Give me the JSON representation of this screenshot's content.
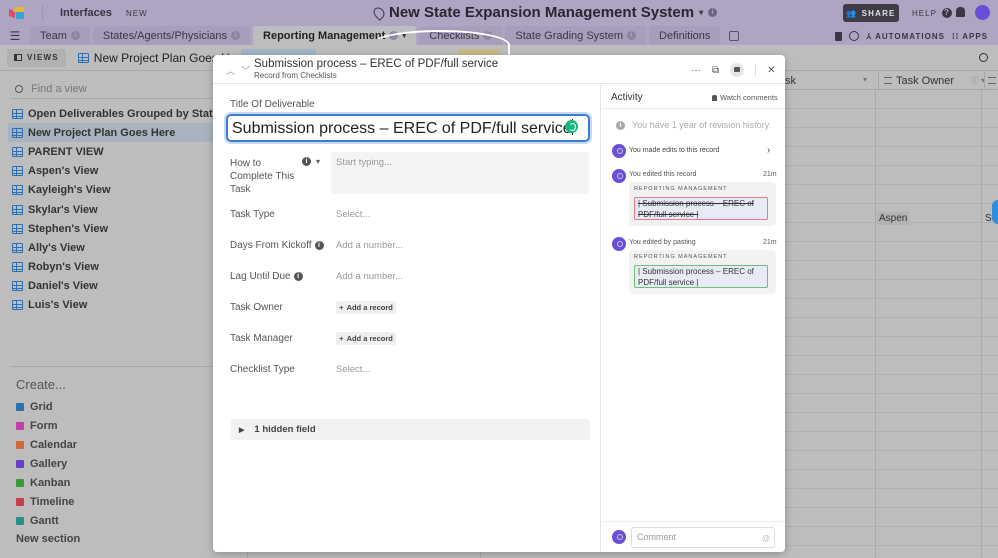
{
  "header": {
    "interfaces_label": "Interfaces",
    "new_badge": "NEW",
    "base_title": "New State Expansion Management System",
    "share_label": "SHARE",
    "help_label": "HELP"
  },
  "tabs": [
    {
      "label": "Team"
    },
    {
      "label": "States/Agents/Physicians"
    },
    {
      "label": "Reporting Management"
    },
    {
      "label": "Checklists"
    },
    {
      "label": "State Grading System"
    },
    {
      "label": "Definitions"
    }
  ],
  "toolbar_right": {
    "automations_label": "AUTOMATIONS",
    "apps_label": "APPS"
  },
  "viewbar": {
    "views_label": "VIEWS",
    "current_view": "New Project Plan Goes Here"
  },
  "sidebar": {
    "find_placeholder": "Find a view",
    "views": [
      {
        "label": "Open Deliverables Grouped by State/Agent/Physicians"
      },
      {
        "label": "New Project Plan Goes Here"
      },
      {
        "label": "PARENT VIEW"
      },
      {
        "label": "Aspen's View"
      },
      {
        "label": "Kayleigh's View"
      },
      {
        "label": "Skylar's View"
      },
      {
        "label": "Stephen's View"
      },
      {
        "label": "Ally's View"
      },
      {
        "label": "Robyn's View"
      },
      {
        "label": "Daniel's View"
      },
      {
        "label": "Luis's View"
      }
    ],
    "create_label": "Create...",
    "create_items": [
      {
        "label": "Grid",
        "color": "#2e6fb0"
      },
      {
        "label": "Form",
        "color": "#c13fa8"
      },
      {
        "label": "Calendar",
        "color": "#d4683a"
      },
      {
        "label": "Gallery",
        "color": "#6b3fc4"
      },
      {
        "label": "Kanban",
        "color": "#3a9a3a"
      },
      {
        "label": "Timeline",
        "color": "#c63d4d"
      },
      {
        "label": "Gantt",
        "color": "#2a8f8a"
      }
    ],
    "new_section_label": "New section"
  },
  "grid": {
    "col_task_partial": "sk",
    "col_task_owner": "Task Owner",
    "cell_owner": "Aspen",
    "cell_next_partial": "St"
  },
  "record": {
    "title": "Submission process – EREC of PDF/full service",
    "subtitle": "Record from Checklists",
    "fields": {
      "title_label": "Title Of Deliverable",
      "title_value": "Submission process – EREC of PDF/full service",
      "how_label": "How to Complete This Task",
      "how_placeholder": "Start typing...",
      "task_type_label": "Task Type",
      "task_type_value": "Select...",
      "days_label": "Days From Kickoff",
      "days_placeholder": "Add a number...",
      "lag_label": "Lag Until Due",
      "lag_placeholder": "Add a number...",
      "owner_label": "Task Owner",
      "owner_button": "Add a record",
      "manager_label": "Task Manager",
      "manager_button": "Add a record",
      "checklist_label": "Checklist Type",
      "checklist_value": "Select...",
      "hidden_fields": "1 hidden field"
    }
  },
  "activity": {
    "title": "Activity",
    "watch_label": "Watch comments",
    "revision_note": "You have 1 year of revision history.",
    "edits_summary": "You made edits to this record",
    "events": [
      {
        "text": "You edited this record",
        "time": "21m",
        "table": "REPORTING MANAGEMENT",
        "content": "| Submission process – EREC of PDF/full service |",
        "kind": "removed"
      },
      {
        "text": "You edited by pasting",
        "time": "21m",
        "table": "REPORTING MANAGEMENT",
        "content": "| Submission process – EREC of PDF/full service |",
        "kind": "added"
      }
    ],
    "comment_placeholder": "Comment"
  }
}
